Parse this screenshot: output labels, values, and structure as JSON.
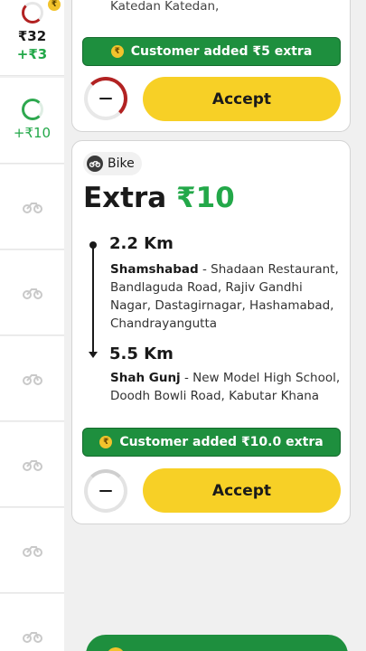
{
  "sidebar": {
    "first": {
      "amount": "₹32",
      "extra": "+₹3"
    },
    "active": {
      "extra": "+₹10"
    },
    "bike_rows": [
      "bike",
      "bike",
      "bike",
      "bike",
      "bike",
      "bike"
    ]
  },
  "top_card": {
    "address_trail": "Katedan Katedan,",
    "banner": "Customer added ₹5 extra",
    "accept_label": "Accept"
  },
  "main_card": {
    "vehicle": "Bike",
    "title_prefix": "Extra",
    "title_amount": "₹10",
    "pickup": {
      "distance": "2.2 Km",
      "name": "Shamshabad",
      "address": " - Shadaan Restaurant, Bandlaguda Road, Rajiv Gandhi Nagar, Dastagirnagar, Hashamabad, Chandrayangutta"
    },
    "drop": {
      "distance": "5.5 Km",
      "name": "Shah Gunj",
      "address": " - New Model High School, Doodh Bowli Road, Kabutar Khana"
    },
    "banner": "Customer added ₹10.0 extra",
    "accept_label": "Accept"
  },
  "coin_symbol": "₹",
  "colors": {
    "accent_green": "#23a849",
    "banner_green": "#1e8f3e",
    "accept_yellow": "#f7d026",
    "timer_red": "#b22222"
  }
}
